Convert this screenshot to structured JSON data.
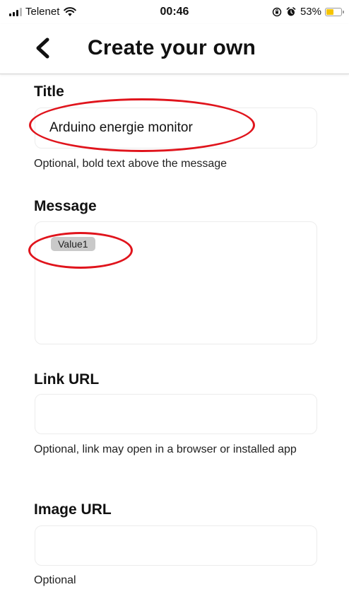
{
  "status_bar": {
    "carrier": "Telenet",
    "time": "00:46",
    "battery_percent": "53%",
    "battery_level": 0.53,
    "battery_color": "#f5c400",
    "icons": [
      "signal-icon",
      "wifi-icon",
      "orientation-lock-icon",
      "alarm-icon",
      "battery-icon"
    ]
  },
  "header": {
    "title": "Create your own",
    "back_icon": "chevron-left-icon"
  },
  "form": {
    "title": {
      "label": "Title",
      "value": "Arduino energie monitor",
      "hint": "Optional, bold text above the message"
    },
    "message": {
      "label": "Message",
      "ingredient": "Value1"
    },
    "link_url": {
      "label": "Link URL",
      "value": "",
      "hint": "Optional, link may open in a browser or installed app"
    },
    "image_url": {
      "label": "Image URL",
      "value": "",
      "hint": "Optional"
    }
  },
  "annotation_color": "#e0141c"
}
